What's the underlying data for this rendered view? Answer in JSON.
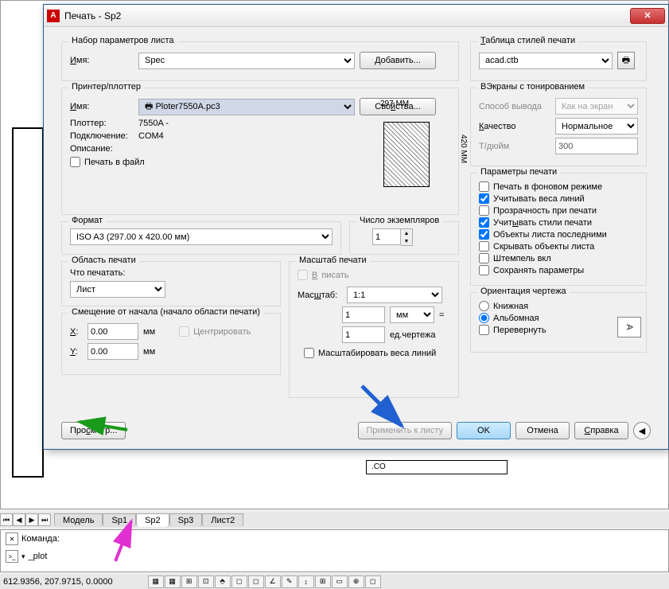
{
  "window": {
    "title": "Печать - Sp2",
    "appicon": "A"
  },
  "page_setup": {
    "title": "Набор параметров листа",
    "name_lbl": "Имя:",
    "name_val": "Spec",
    "add_btn": "Добавить..."
  },
  "printer": {
    "title": "Принтер/плоттер",
    "name_lbl": "Имя:",
    "name_val": "Ploter7550A.pc3",
    "props_btn": "Свойства...",
    "plotter_lbl": "Плоттер:",
    "plotter_val": "7550A -",
    "port_lbl": "Подключение:",
    "port_val": "COM4",
    "desc_lbl": "Описание:",
    "tofile_lbl": "Печать в файл",
    "preview_w": "297 MM",
    "preview_h": "420 MM"
  },
  "paper": {
    "title": "Формат",
    "val": "ISO A3 (297.00 x 420.00 мм)"
  },
  "copies": {
    "title": "Число экземпляров",
    "val": "1"
  },
  "area": {
    "title": "Область печати",
    "what_lbl": "Что печатать:",
    "what_val": "Лист"
  },
  "scale": {
    "title": "Масштаб печати",
    "fit_lbl": "Вписать",
    "scale_lbl": "Масштаб:",
    "scale_val": "1:1",
    "unit_top": "1",
    "unit_sel": "мм",
    "eq": "=",
    "unit_bot": "1",
    "unit_bot_lbl": "ед.чертежа",
    "scale_lw_lbl": "Масштабировать веса линий"
  },
  "offset": {
    "title": "Смещение от начала (начало области печати)",
    "x_lbl": "X:",
    "x_val": "0.00",
    "x_unit": "мм",
    "y_lbl": "Y:",
    "y_val": "0.00",
    "y_unit": "мм",
    "center_lbl": "Центрировать"
  },
  "style": {
    "title": "Таблица стилей печати",
    "val": "acad.ctb"
  },
  "shade": {
    "title": "ВЭкраны с тонированием",
    "mode_lbl": "Способ вывода",
    "mode_val": "Как на экране",
    "qual_lbl": "Качество",
    "qual_val": "Нормальное",
    "dpi_lbl": "Т/дюйм",
    "dpi_val": "300"
  },
  "options": {
    "title": "Параметры печати",
    "o1": "Печать в фоновом режиме",
    "o2": "Учитывать веса линий",
    "o3": "Прозрачность при печати",
    "o4": "Учитывать стили печати",
    "o5": "Объекты листа последними",
    "o6": "Скрывать объекты листа",
    "o7": "Штемпель вкл",
    "o8": "Сохранять параметры"
  },
  "orient": {
    "title": "Ориентация чертежа",
    "portrait": "Книжная",
    "landscape": "Альбомная",
    "upside": "Перевернуть",
    "icon": "A"
  },
  "buttons": {
    "preview": "Просмотр...",
    "apply": "Применить к листу",
    "ok": "OK",
    "cancel": "Отмена",
    "help": "Справка"
  },
  "tabs": [
    "Модель",
    "Sp1",
    "Sp2",
    "Sp3",
    "Лист2"
  ],
  "cmd": {
    "label": "Команда:",
    "icon": ">_",
    "text": "_plot"
  },
  "status": {
    "coords": "612.9356, 207.9715, 0.0000"
  },
  "bg": {
    "co": ".CO"
  }
}
